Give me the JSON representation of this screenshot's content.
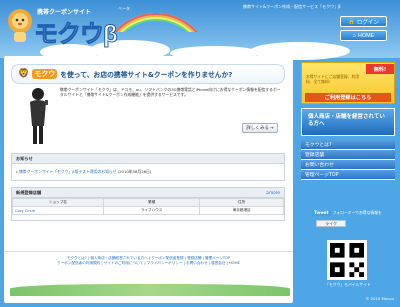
{
  "header": {
    "tagline": "携帯サイト&クーポン作成・配信サービス「モクウ」β",
    "logo_small": "携帯クーポンサイト",
    "logo_big": "モクウβ",
    "logo_ruby": "ベータ",
    "login": "ログイン",
    "home": "HOME"
  },
  "hero": {
    "brand": "モクウ",
    "headline": "を使って、お店の携帯サイト&クーポンを作りませんか?",
    "desc": "携帯クーポンサイト「モクウ」は、ドコモ、au、ソフトバンクの3G携帯電話とiPhone向けにお得なクーポン情報を配信するポータルサイトと「携帯サイト&クーポン作成機能」を提供するサービスです。",
    "more": "詳しくみる"
  },
  "news": {
    "title": "お知らせ",
    "item": "携帯クーポンサイト「モクウ」β版テスト運用のお知らせ",
    "date": "(2010年08月26日)"
  },
  "shops": {
    "title": "新規登録店舗",
    "more": "more",
    "cols": [
      "ショップ名",
      "業種",
      "住所"
    ],
    "rows": [
      [
        "Cozy Circle",
        "ライブハウス",
        "東京都港区"
      ]
    ]
  },
  "footer": {
    "line1": [
      "モクウとは?",
      "個人商店・店舗経営されている方へ",
      "クーポン配信者登録",
      "登録店舗",
      "管理ページTOP"
    ],
    "line2": [
      "クーポン配信者の利用規約",
      "サイトのご利用について",
      "プライバシーポリシー",
      "お問い合わせ",
      "運営会社",
      "HOME"
    ],
    "copyright": "© 2010 Mocuu"
  },
  "side": {
    "free": "無料!",
    "reg_small": "お得サイトにご店舗登録、利用料、全て無料!",
    "reg_btn": "ご利用登録はこちら",
    "owner": "個人商店・店舗を経営されている方へ",
    "menu": [
      "モクウとは?",
      "登録店舗",
      "お問い合わせ",
      "管理ページTOP"
    ],
    "twitter": "Tweet",
    "twitter_note": "フォローミーでお得な情報を",
    "like": "ライク",
    "qr_label": "「モクウ」モバイルサイト"
  }
}
